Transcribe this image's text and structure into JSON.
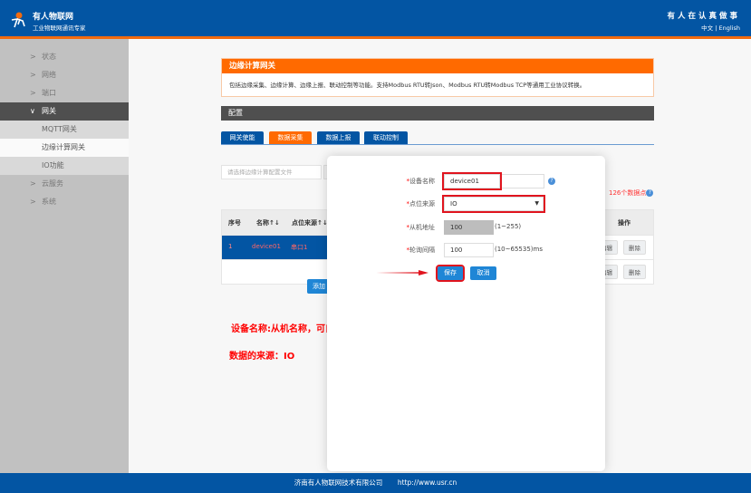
{
  "header": {
    "brand": "有人物联网",
    "brand_sub": "工业物联网通讯专家",
    "slogan": "有人在认真做事",
    "lang_zh": "中文",
    "lang_sep": "|",
    "lang_en": "English"
  },
  "sidebar": {
    "items": [
      {
        "label": "状态",
        "chev": ">"
      },
      {
        "label": "网络",
        "chev": ">"
      },
      {
        "label": "端口",
        "chev": ">"
      },
      {
        "label": "网关",
        "chev": "∨"
      },
      {
        "label": "MQTT网关"
      },
      {
        "label": "边缘计算网关"
      },
      {
        "label": "IO功能"
      },
      {
        "label": "云服务",
        "chev": ">"
      },
      {
        "label": "系统",
        "chev": ">"
      }
    ]
  },
  "notice": {
    "title": "边缘计算网关",
    "desc": "包括边缘采集、边缘计算、边缘上报、联动控制等功能。支持Modbus RTU转Json、Modbus RTU转Modbus TCP等通用工业协议转换。"
  },
  "config": {
    "title": "配置",
    "tabs": [
      "网关使能",
      "数据采集",
      "数据上报",
      "联动控制"
    ],
    "active_tab": "数据采集"
  },
  "file": {
    "placeholder": "请选择边缘计算配置文件"
  },
  "points": {
    "count_text": "126个数据点",
    "help": "?"
  },
  "table": {
    "headers": [
      "序号",
      "名称↑↓",
      "点位来源↑↓",
      "操作"
    ],
    "rows": [
      {
        "index": "1",
        "name": "device01",
        "source": "串口1",
        "edit": "编辑",
        "delete": "删除"
      },
      {
        "edit": "编辑",
        "delete": "删除"
      }
    ]
  },
  "add_button": "添加",
  "modal": {
    "fields": [
      {
        "label": "设备名称",
        "value": "device01",
        "help": "?"
      },
      {
        "label": "点位来源",
        "value": "IO"
      },
      {
        "label": "从机地址",
        "value": "100",
        "hint": "(1~255)"
      },
      {
        "label": "轮询间隔",
        "value": "100",
        "hint": "(10~65535)ms"
      }
    ],
    "required_mark": "*",
    "save": "保存",
    "cancel": "取消"
  },
  "annotations": {
    "line1": "设备名称:从机名称，可自定义，不可为中文，不可与其他从机名称重复",
    "line2": "数据的来源：IO"
  },
  "footer": {
    "company": "济南有人物联网技术有限公司",
    "url": "http://www.usr.cn"
  },
  "colors": {
    "header": "#0355a3",
    "accent": "#ff6a00",
    "highlight": "#e0141e"
  }
}
